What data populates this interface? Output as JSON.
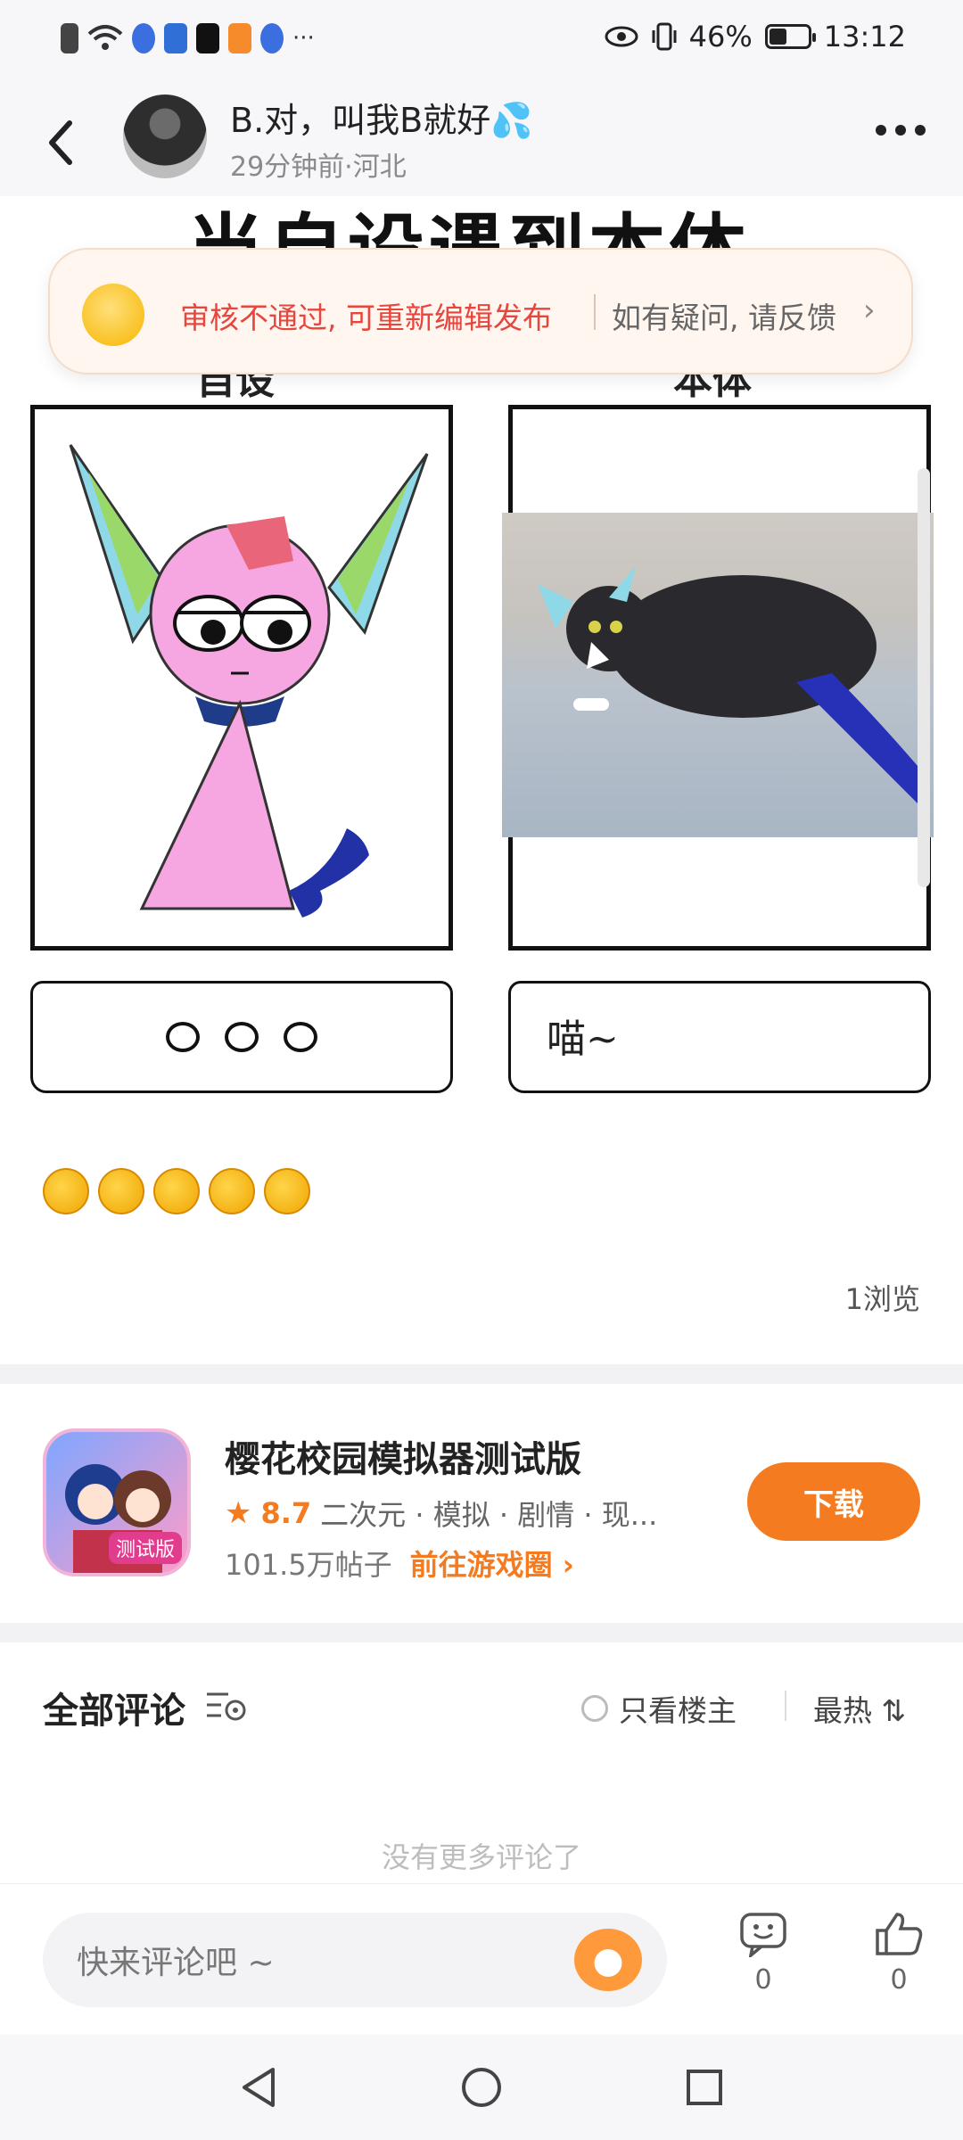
{
  "status_bar": {
    "battery_percent": "46%",
    "battery_level": 0.46,
    "time": "13:12",
    "more_dots": "···"
  },
  "header": {
    "username": "B.对，叫我B就好💦",
    "meta": "29分钟前·河北"
  },
  "post": {
    "comic_title": "当自设遇到本体",
    "panel_left_label": "自设",
    "panel_right_label": "本体",
    "speech_right": "喵~",
    "emojis": [
      "🤣",
      "🤣",
      "🤣",
      "🤣",
      "🤣"
    ],
    "views": "1浏览"
  },
  "review_banner": {
    "message": "审核不通过, 可重新编辑发布",
    "help_text": "如有疑问, 请反馈",
    "arrow": "›"
  },
  "game_card": {
    "name": "樱花校园模拟器测试版",
    "badge": "测试版",
    "rating": "8.7",
    "tags": "二次元 · 模拟 · 剧情 · 现...",
    "posts": "101.5万帖子",
    "link": "前往游戏圈 ›",
    "download_label": "下载"
  },
  "comments": {
    "title": "全部评论",
    "only_op_label": "只看楼主",
    "sort_label": "最热 ⇅",
    "no_more": "没有更多评论了"
  },
  "bottom_bar": {
    "input_placeholder": "快来评论吧 ~",
    "comment_count": "0",
    "like_count": "0"
  },
  "colors": {
    "accent": "#f47b20",
    "warning_text": "#e8453c",
    "divider": "#f2f2f4"
  }
}
